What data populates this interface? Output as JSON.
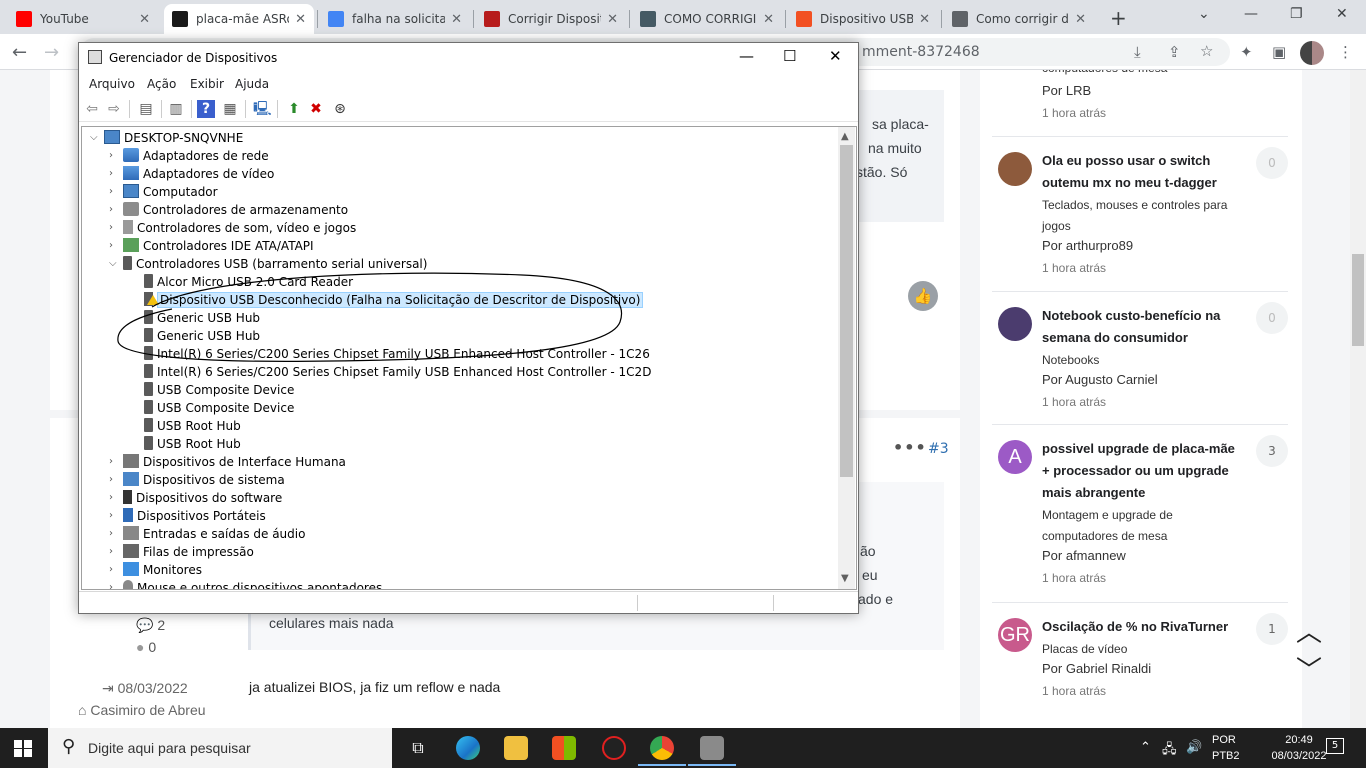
{
  "browser": {
    "tabs": [
      {
        "title": "YouTube",
        "color": "#ff0000"
      },
      {
        "title": "placa-mãe ASRock",
        "color": "#1a1a1a"
      },
      {
        "title": "falha na solicitação",
        "color": "#4285f4"
      },
      {
        "title": "Corrigir Dispositivo",
        "color": "#b71c1c"
      },
      {
        "title": "COMO CORRIGIR",
        "color": "#455a64"
      },
      {
        "title": "Dispositivo USB d",
        "color": "#f25022"
      },
      {
        "title": "Como corrigir dis",
        "color": "#5f6368"
      }
    ],
    "url_visible": "mment-8372468"
  },
  "device_manager": {
    "title": "Gerenciador de Dispositivos",
    "menu": [
      "Arquivo",
      "Ação",
      "Exibir",
      "Ajuda"
    ],
    "root": "DESKTOP-SNQVNHE",
    "categories_before": [
      {
        "label": "Adaptadores de rede",
        "icon": "net"
      },
      {
        "label": "Adaptadores de vídeo",
        "icon": "vid"
      },
      {
        "label": "Computador",
        "icon": "pc"
      },
      {
        "label": "Controladores de armazenamento",
        "icon": "stor"
      },
      {
        "label": "Controladores de som, vídeo e jogos",
        "icon": "snd"
      },
      {
        "label": "Controladores IDE ATA/ATAPI",
        "icon": "ide"
      }
    ],
    "usb_category": "Controladores USB (barramento serial universal)",
    "usb_devices": [
      {
        "label": "Alcor Micro USB 2.0 Card Reader",
        "warn": false
      },
      {
        "label": "Dispositivo USB Desconhecido (Falha na Solicitação de Descritor de Dispositivo)",
        "warn": true
      },
      {
        "label": "Generic USB Hub",
        "warn": false
      },
      {
        "label": "Generic USB Hub",
        "warn": false
      },
      {
        "label": "Intel(R) 6 Series/C200 Series Chipset Family USB Enhanced Host Controller - 1C26",
        "warn": false
      },
      {
        "label": "Intel(R) 6 Series/C200 Series Chipset Family USB Enhanced Host Controller - 1C2D",
        "warn": false
      },
      {
        "label": "USB Composite Device",
        "warn": false
      },
      {
        "label": "USB Composite Device",
        "warn": false
      },
      {
        "label": "USB Root Hub",
        "warn": false
      },
      {
        "label": "USB Root Hub",
        "warn": false
      }
    ],
    "categories_after": [
      {
        "label": "Dispositivos de Interface Humana",
        "icon": "hid"
      },
      {
        "label": "Dispositivos de sistema",
        "icon": "sys"
      },
      {
        "label": "Dispositivos do software",
        "icon": "soft"
      },
      {
        "label": "Dispositivos Portáteis",
        "icon": "port"
      },
      {
        "label": "Entradas e saídas de áudio",
        "icon": "aud"
      },
      {
        "label": "Filas de impressão",
        "icon": "prn"
      },
      {
        "label": "Monitores",
        "icon": "mon"
      },
      {
        "label": "Mouse e outros dispositivos apontadores",
        "icon": "mouse"
      }
    ]
  },
  "post": {
    "frag1": "sa placa-",
    "frag2": "na muito",
    "frag3": "stão. Só",
    "frag4": "ão",
    "frag5": "eu",
    "frag6": "ado e",
    "quote_last_line": "celulares mais nada",
    "post_number": "#3",
    "comments_count": "2",
    "likes_count": "0",
    "date": "08/03/2022",
    "location": "Casimiro de Abreu",
    "text": "ja atualizei BIOS, ja fiz um reflow e nada"
  },
  "sidebar": {
    "top_fragment": "computadores de mesa",
    "top_by": "Por LRB",
    "top_time": "1 hora atrás",
    "items": [
      {
        "title": "Ola eu posso usar o switch outemu mx no meu t-dagger",
        "category": "Teclados, mouses e controles para jogos",
        "by": "Por arthurpro89",
        "time": "1 hora atrás",
        "count": "0",
        "avatar_letter": "",
        "avatar_color": "#8d5a3c"
      },
      {
        "title": "Notebook custo-benefício na semana do consumidor",
        "category": "Notebooks",
        "by": "Por Augusto Carniel",
        "time": "1 hora atrás",
        "count": "0",
        "avatar_letter": "",
        "avatar_color": "#4b3c6e"
      },
      {
        "title": "possivel upgrade de placa-mãe + processador ou um upgrade mais abrangente",
        "category": "Montagem e upgrade de computadores de mesa",
        "by": "Por afmannew",
        "time": "1 hora atrás",
        "count": "3",
        "avatar_letter": "A",
        "avatar_color": "#9c5ac6"
      },
      {
        "title": "Oscilação de % no RivaTurner",
        "category": "Placas de vídeo",
        "by": "Por Gabriel Rinaldi",
        "time": "1 hora atrás",
        "count": "1",
        "avatar_letter": "GR",
        "avatar_color": "#c85a8c"
      }
    ]
  },
  "taskbar": {
    "search_placeholder": "Digite aqui para pesquisar",
    "lang_top": "POR",
    "lang_bottom": "PTB2",
    "time": "20:49",
    "date": "08/03/2022",
    "notifications": "5"
  }
}
